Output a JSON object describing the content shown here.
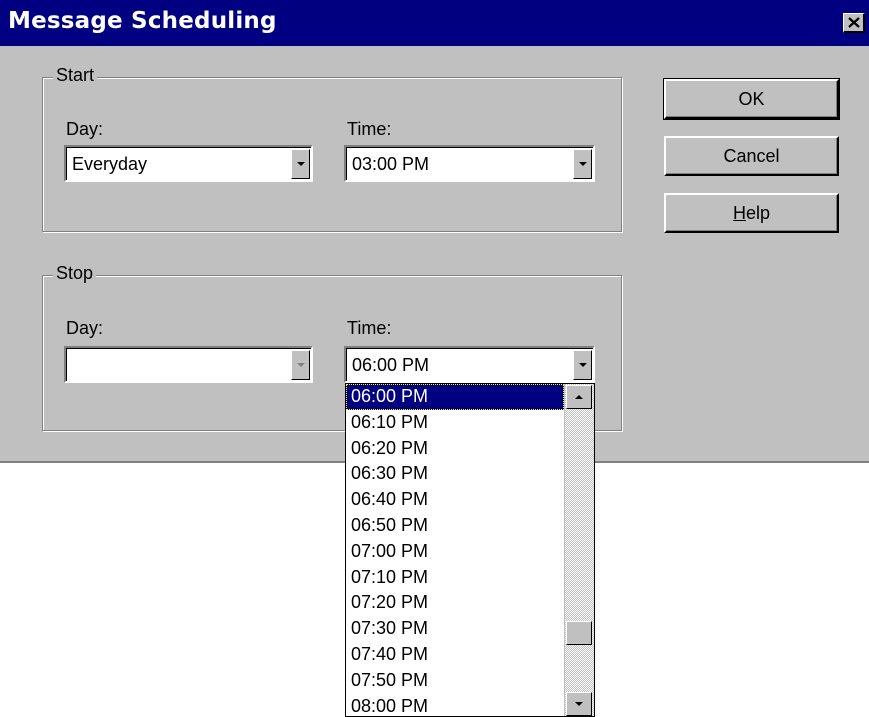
{
  "window": {
    "title": "Message Scheduling",
    "close_icon": "close-icon"
  },
  "start": {
    "legend": "Start",
    "day_label": "Day:",
    "day_value": "Everyday",
    "time_label": "Time:",
    "time_value": "03:00 PM"
  },
  "stop": {
    "legend": "Stop",
    "day_label": "Day:",
    "day_value": "",
    "time_label": "Time:",
    "time_value": "06:00 PM"
  },
  "buttons": {
    "ok": "OK",
    "cancel": "Cancel",
    "help_mnemonic": "H",
    "help_rest": "elp"
  },
  "time_dropdown": {
    "selected": "06:00 PM",
    "options": [
      "06:00 PM",
      "06:10 PM",
      "06:20 PM",
      "06:30 PM",
      "06:40 PM",
      "06:50 PM",
      "07:00 PM",
      "07:10 PM",
      "07:20 PM",
      "07:30 PM",
      "07:40 PM",
      "07:50 PM",
      "08:00 PM"
    ]
  },
  "colors": {
    "titlebar": "#000080",
    "face": "#c0c0c0",
    "selection": "#000080"
  }
}
